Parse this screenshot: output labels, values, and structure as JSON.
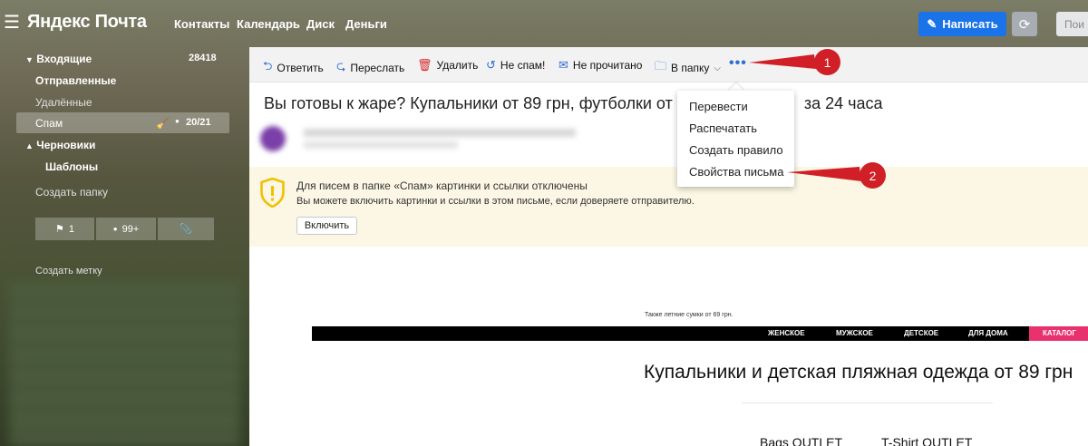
{
  "header": {
    "logo": "Яндекс Почта",
    "nav": [
      "Контакты",
      "Календарь",
      "Диск",
      "Деньги"
    ],
    "write_label": "Написать",
    "search_stub": "Пои"
  },
  "sidebar": {
    "inbox": {
      "label": "Входящие",
      "count": "28418"
    },
    "sent": "Отправленные",
    "deleted": "Удалённые",
    "spam": {
      "label": "Спам",
      "count": "20/21"
    },
    "drafts": "Черновики",
    "templates": "Шаблоны",
    "create_folder": "Создать папку",
    "filters": {
      "flag_count": "1",
      "unread_count": "99+"
    },
    "create_label": "Создать метку"
  },
  "toolbar": {
    "reply": "Ответить",
    "forward": "Переслать",
    "delete": "Удалить",
    "not_spam": "Не спам!",
    "unread": "Не прочитано",
    "to_folder": "В папку"
  },
  "message": {
    "subject_part1": "Вы готовы к жаре? Купальники от 89 грн, футболки от 99",
    "subject_part2": "за 24 часа",
    "warning_title": "Для писем в папке «Спам» картинки и ссылки отключены",
    "warning_text": "Вы можете включить картинки и ссылки в этом письме, если доверяете отправителю.",
    "enable_button": "Включить"
  },
  "promo": {
    "note": "Также летние сумки от 69 грн.",
    "menu": [
      "ЖЕНСКОЕ",
      "МУЖСКОЕ",
      "ДЕТСКОЕ",
      "ДЛЯ ДОМА",
      "КАТАЛОГ"
    ],
    "title": "Купальники и детская пляжная одежда от 89 грн",
    "bags": "Bags OUTLET",
    "tshirt": "T-Shirt OUTLET"
  },
  "dropdown": {
    "items": [
      "Перевести",
      "Распечатать",
      "Создать правило",
      "Свойства письма"
    ]
  },
  "callouts": [
    "1",
    "2"
  ],
  "colors": {
    "accent": "#1a73e8",
    "callout": "#d11f27",
    "catalog": "#e8326e",
    "link_blue": "#2f6fd1"
  },
  "icons": [
    "menu-icon",
    "pencil-icon",
    "refresh-icon",
    "reply-icon",
    "forward-icon",
    "trash-icon",
    "undo-icon",
    "envelope-icon",
    "folder-icon",
    "more-icon",
    "shield-icon",
    "flag-icon",
    "paperclip-icon"
  ]
}
